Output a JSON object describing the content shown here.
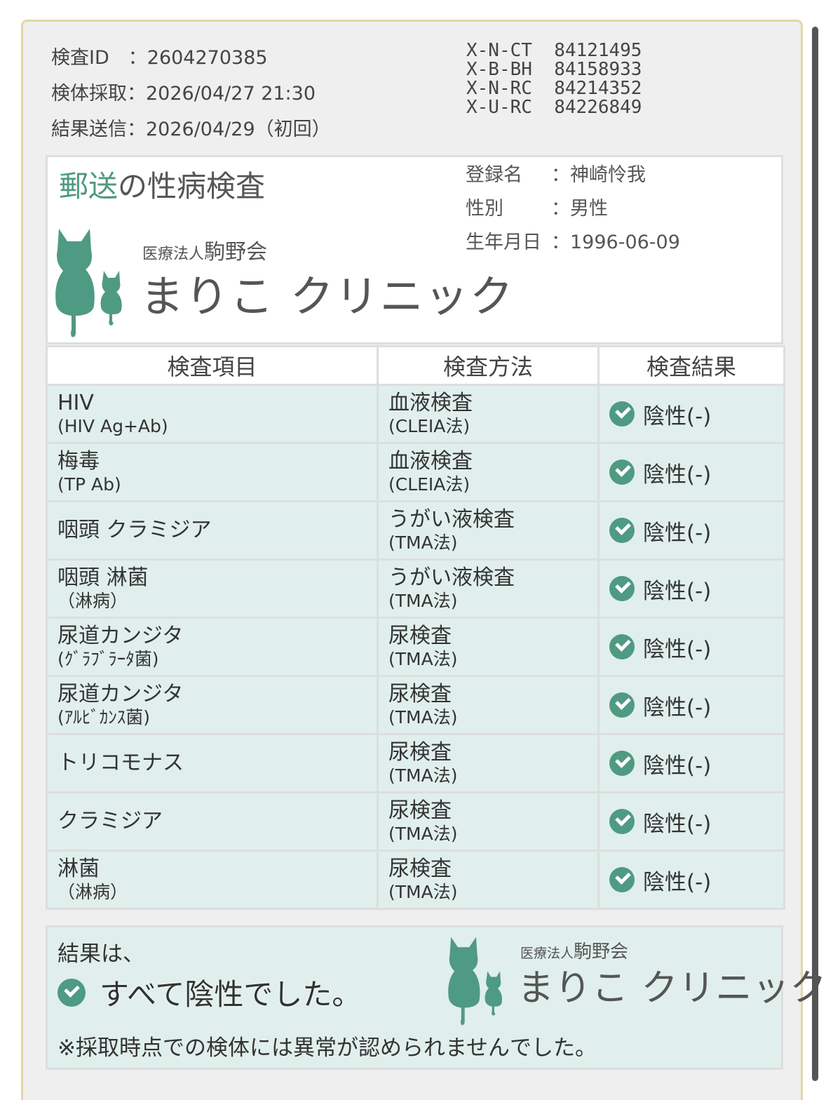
{
  "meta": {
    "test_id_label": "検査ID　：",
    "test_id": "2604270385",
    "sampled_label": "検体採取：",
    "sampled": "2026/04/27  21:30",
    "sent_label": "結果送信：",
    "sent": "2026/04/29（初回）"
  },
  "codes": [
    "X-N-CT  84121495",
    "X-B-BH  84158933",
    "X-N-RC  84214352",
    "X-U-RC  84226849"
  ],
  "panel": {
    "title_accent": "郵送",
    "title_rest": "の性病検査",
    "clinic_corp_small": "医療法人",
    "clinic_corp_big": "駒野会",
    "clinic_name": "まりこ クリニック",
    "name_label": "登録名",
    "name_value": "：神崎怜我",
    "sex_label": "性別",
    "sex_value": "：男性",
    "dob_label": "生年月日",
    "dob_value": "：1996-06-09"
  },
  "table": {
    "headers": [
      "検査項目",
      "検査方法",
      "検査結果"
    ],
    "rows": [
      {
        "item": "HIV",
        "item_sub": "(HIV  Ag+Ab)",
        "method": "血液検査",
        "method_sub": "(CLEIA法)",
        "result": "陰性(-)"
      },
      {
        "item": "梅毒",
        "item_sub": "(TP  Ab)",
        "method": "血液検査",
        "method_sub": "(CLEIA法)",
        "result": "陰性(-)"
      },
      {
        "item": "咽頭  クラミジア",
        "item_sub": "",
        "method": "うがい液検査",
        "method_sub": "(TMA法)",
        "result": "陰性(-)"
      },
      {
        "item": "咽頭  淋菌",
        "item_sub": "（淋病）",
        "method": "うがい液検査",
        "method_sub": "(TMA法)",
        "result": "陰性(-)"
      },
      {
        "item": "尿道カンジタ",
        "item_sub": "(ｸﾞﾗﾌﾞﾗｰﾀ菌)",
        "method": "尿検査",
        "method_sub": "(TMA法)",
        "result": "陰性(-)"
      },
      {
        "item": "尿道カンジタ",
        "item_sub": "(ｱﾙﾋﾞｶﾝｽ菌)",
        "method": "尿検査",
        "method_sub": "(TMA法)",
        "result": "陰性(-)"
      },
      {
        "item": "トリコモナス",
        "item_sub": "",
        "method": "尿検査",
        "method_sub": "(TMA法)",
        "result": "陰性(-)"
      },
      {
        "item": "クラミジア",
        "item_sub": "",
        "method": "尿検査",
        "method_sub": "(TMA法)",
        "result": "陰性(-)"
      },
      {
        "item": "淋菌",
        "item_sub": "（淋病）",
        "method": "尿検査",
        "method_sub": "(TMA法)",
        "result": "陰性(-)"
      }
    ]
  },
  "summary": {
    "lead": "結果は、",
    "main": "すべて陰性でした。",
    "note": "※採取時点での検体には異常が認められませんでした。"
  },
  "colors": {
    "accent": "#4f9a82",
    "row_bg": "#e0efec",
    "border": "#e3d6a8"
  }
}
